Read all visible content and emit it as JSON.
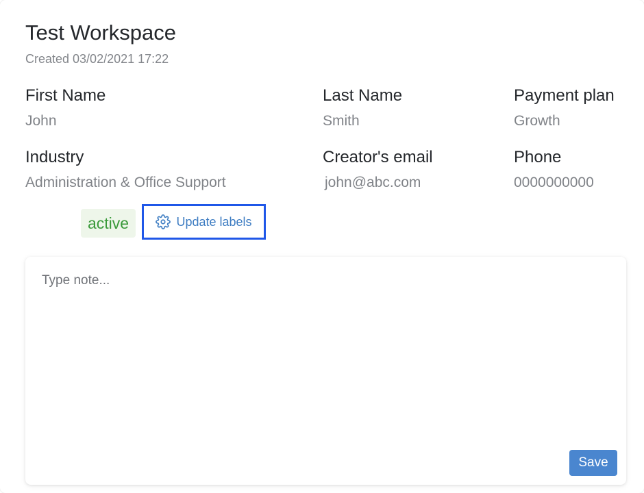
{
  "workspace": {
    "title": "Test Workspace",
    "created": "Created 03/02/2021 17:22"
  },
  "fields": {
    "first_name": {
      "label": "First Name",
      "value": "John"
    },
    "last_name": {
      "label": "Last Name",
      "value": "Smith"
    },
    "payment_plan": {
      "label": "Payment plan",
      "value": "Growth"
    },
    "industry": {
      "label": "Industry",
      "value": "Administration & Office Support"
    },
    "creator_email": {
      "label": "Creator's email",
      "value": "john@abc.com"
    },
    "phone": {
      "label": "Phone",
      "value": "0000000000"
    }
  },
  "labels": {
    "status": "active",
    "update_button": "Update labels",
    "update_icon": "gear-icon"
  },
  "note": {
    "placeholder": "Type note...",
    "value": "",
    "save_label": "Save"
  },
  "colors": {
    "status_text": "#3a9a3a",
    "status_bg": "#eef6ea",
    "link": "#3d7cc2",
    "highlight_border": "#1f57e8",
    "save_button": "#4a86cf"
  }
}
